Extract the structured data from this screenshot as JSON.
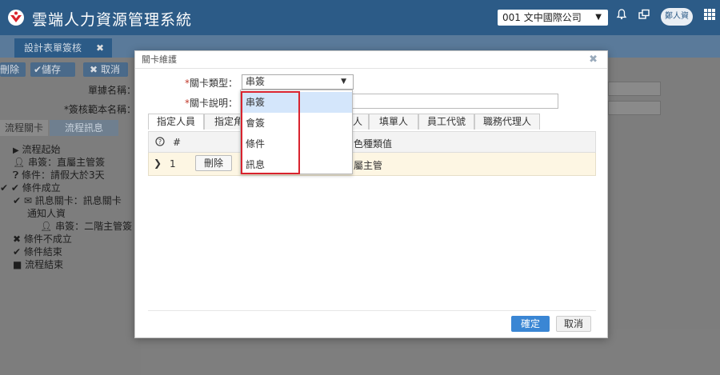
{
  "app": {
    "title": "雲端人力資源管理系統"
  },
  "header": {
    "company": "001 文中國際公司",
    "user": "鄭人資",
    "icons": [
      "bell-icon",
      "windows-icon",
      "grid-icon"
    ]
  },
  "tabbar": {
    "active_tab": "設計表單簽核",
    "close": "✖"
  },
  "toolbar": {
    "delete": "刪除",
    "save": "儲存",
    "cancel": "取消"
  },
  "form": {
    "doc_name_label": "單據名稱：",
    "template_label": "*簽核範本名稱："
  },
  "left_tabs": [
    "流程關卡",
    "流程訊息"
  ],
  "tree": [
    {
      "icon": "play-icon",
      "text": "流程起始"
    },
    {
      "icon": "user-icon",
      "text": "串簽：直屬主管簽"
    },
    {
      "icon": "question-icon",
      "text": "條件：請假大於3天"
    },
    {
      "icon": "check-icon",
      "text": "條件成立"
    },
    {
      "icon": "envelope-icon",
      "text": "訊息關卡：訊息關卡"
    },
    {
      "icon": "",
      "text": "通知人資"
    },
    {
      "icon": "user-icon",
      "text": "串簽：二階主管簽"
    },
    {
      "icon": "x-icon",
      "text": "條件不成立"
    },
    {
      "icon": "check-circle-icon",
      "text": "條件結束"
    },
    {
      "icon": "square-icon",
      "text": "流程結束"
    }
  ],
  "modal": {
    "title": "關卡維護",
    "close": "✖",
    "type_label": "關卡類型：",
    "type_value": "串簽",
    "desc_label": "關卡說明：",
    "desc_value": "",
    "tabs": [
      "指定人員",
      "指定角",
      "人",
      "填單人",
      "員工代號",
      "職務代理人"
    ],
    "table": {
      "headers": [
        "#",
        "色種類值"
      ],
      "rows": [
        {
          "index": "1",
          "delete": "刪除",
          "value": "屬主管"
        }
      ]
    },
    "ok": "確定",
    "cancel": "取消"
  },
  "dropdown": {
    "options": [
      "串簽",
      "會簽",
      "條件",
      "訊息"
    ],
    "selected": "串簽"
  },
  "colors": {
    "header": "#2c5b87",
    "primary_button": "#3a86d4",
    "highlight": "#d9232e"
  }
}
